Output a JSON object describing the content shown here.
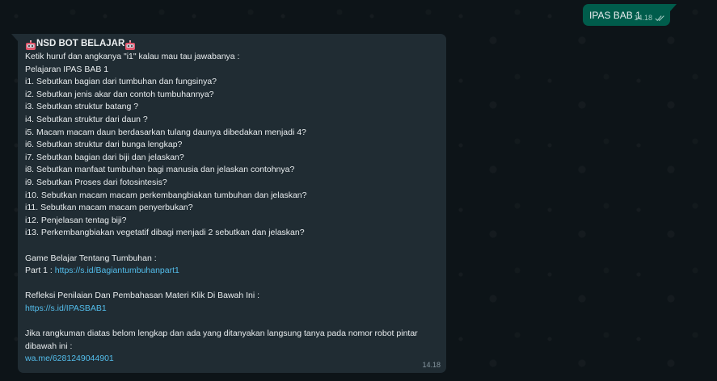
{
  "outgoing": {
    "text": "IPAS BAB 1",
    "time": "14.18",
    "status_icon": "double-check-icon"
  },
  "incoming": {
    "time": "14.18",
    "icons": [
      "robot-icon",
      "robot-icon"
    ],
    "title": "NSD BOT BELAJAR",
    "intro": "Ketik huruf dan angkanya \"i1\" kalau mau tau jawabanya :",
    "subject": "Pelajaran IPAS BAB 1",
    "questions": [
      "i1. Sebutkan bagian dari tumbuhan dan fungsinya?",
      "i2. Sebutkan jenis akar dan contoh tumbuhannya?",
      "i3. Sebutkan struktur batang ?",
      "i4. Sebutkan struktur dari daun ?",
      "i5. Macam macam daun berdasarkan tulang daunya dibedakan menjadi 4?",
      "i6. Sebutkan struktur dari bunga lengkap?",
      "i7. Sebutkan bagian dari biji dan jelaskan?",
      "i8. Sebutkan manfaat tumbuhan bagi manusia dan jelaskan contohnya?",
      "i9. Sebutkan Proses dari fotosintesis?",
      "i10. Sebutkan macam macam perkembangbiakan tumbuhan dan jelaskan?",
      "i11. Sebutkan macam macam penyerbukan?",
      "i12. Penjelasan tentag biji?",
      "i13. Perkembangbiakan vegetatif dibagi menjadi 2 sebutkan dan jelaskan?"
    ],
    "game_heading": "Game Belajar Tentang Tumbuhan :",
    "part_label": "Part 1 : ",
    "part_link": "https://s.id/Bagiantumbuhanpart1",
    "reflection_heading": "Refleksi Penilaian Dan Pembahasan Materi Klik Di Bawah Ini :",
    "reflection_link": "https://s.id/IPASBAB1",
    "footer_text": "Jika rangkuman diatas belom lengkap dan ada yang ditanyakan langsung tanya pada nomor robot pintar dibawah ini :",
    "contact_link": "wa.me/6281249044901"
  },
  "colors": {
    "background": "#0d1418",
    "outgoing_bubble": "#005c4b",
    "incoming_bubble": "#202c33",
    "link": "#53bdeb",
    "text": "#e9edef",
    "meta": "#8696a0"
  }
}
